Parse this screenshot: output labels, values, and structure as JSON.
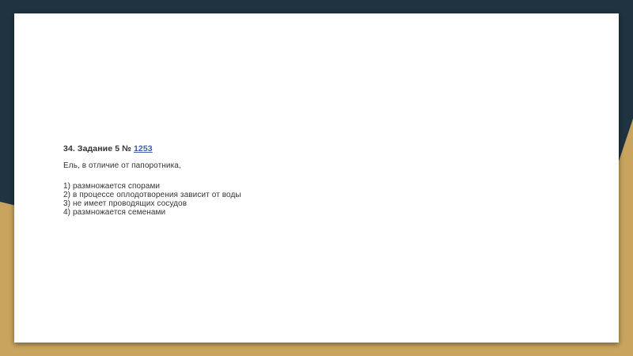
{
  "colors": {
    "background_dark": "#1f3340",
    "background_gold": "#c8a45e",
    "slide_background": "#ffffff",
    "text": "#333333",
    "link": "#3b5fa8"
  },
  "task": {
    "title_prefix": "34. Задание 5 № ",
    "number_link": "1253",
    "question": "Ель, в отличие от папоротника,",
    "options": [
      "1) размножается спорами",
      "2) в процессе оплодотворения зависит от воды",
      "3) не имеет проводящих сосудов",
      "4) размножается семенами"
    ]
  }
}
